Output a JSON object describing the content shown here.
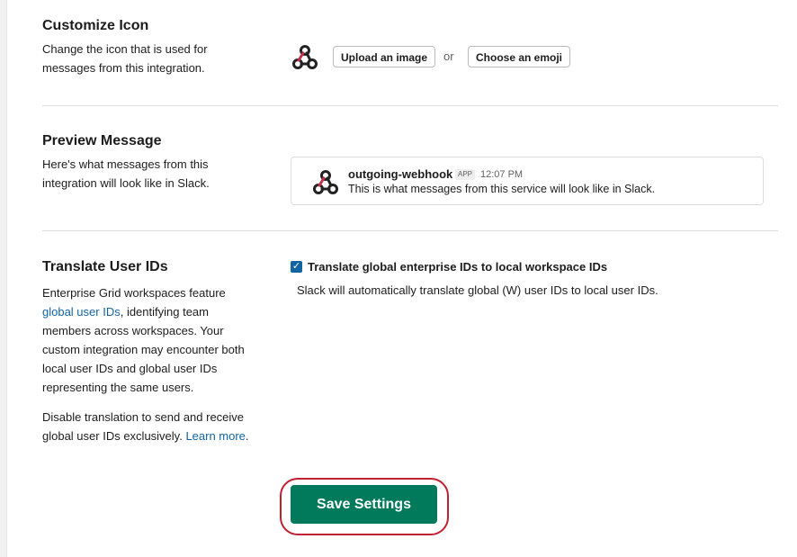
{
  "customize_icon": {
    "title": "Customize Icon",
    "description_line1": "Change the icon that is used for",
    "description_line2": "messages from this integration.",
    "upload_label": "Upload an image",
    "or_label": "or",
    "emoji_label": "Choose an emoji"
  },
  "preview_message": {
    "title": "Preview Message",
    "description_line1": "Here's what messages from this",
    "description_line2": "integration will look like in Slack.",
    "bot_name": "outgoing-webhook",
    "badge": "APP",
    "time": "12:07 PM",
    "text": "This is what messages from this service will look like in Slack."
  },
  "translate_ids": {
    "title": "Translate User IDs",
    "desc_line1": "Enterprise Grid workspaces feature",
    "desc_link": "global user IDs",
    "desc_line2_rest": ", identifying team",
    "desc_line3": "members across workspaces. Your",
    "desc_line4": "custom integration may encounter both",
    "desc_line5": "local user IDs and global user IDs",
    "desc_line6": "representing the same users.",
    "desc2_line1": "Disable translation to send and receive",
    "desc2_line2": "global user IDs exclusively. ",
    "learn_more": "Learn more",
    "learn_more_suffix": ".",
    "checkbox_label": "Translate global enterprise IDs to local workspace IDs",
    "checkbox_checked": true,
    "checkbox_help": "Slack will automatically translate global (W) user IDs to local user IDs."
  },
  "save": {
    "label": "Save Settings"
  },
  "colors": {
    "save_green": "#007a5a",
    "link_blue": "#1264a3",
    "highlight_red": "#c0202f"
  },
  "icons": {
    "integration": "webhook-icon"
  }
}
